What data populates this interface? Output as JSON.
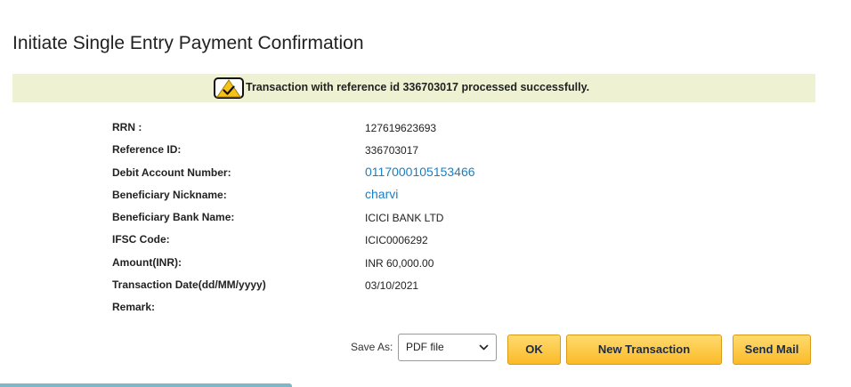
{
  "page": {
    "title": "Initiate Single Entry Payment Confirmation"
  },
  "banner": {
    "icon": "success-check-icon",
    "message": "Transaction with reference id 336703017 processed successfully.",
    "background": "#eef2d3"
  },
  "details": [
    {
      "label": "RRN :",
      "value": "127619623693",
      "link": false
    },
    {
      "label": "Reference ID:",
      "value": "336703017",
      "link": false
    },
    {
      "label": "Debit Account Number:",
      "value": "0117000105153466",
      "link": true
    },
    {
      "label": "Beneficiary Nickname:",
      "value": "charvi",
      "link": true
    },
    {
      "label": "Beneficiary Bank Name:",
      "value": "ICICI BANK LTD",
      "link": false
    },
    {
      "label": "IFSC Code:",
      "value": "ICIC0006292",
      "link": false
    },
    {
      "label": "Amount(INR):",
      "value": "INR 60,000.00",
      "link": false
    },
    {
      "label": "Transaction Date(dd/MM/yyyy)",
      "value": "03/10/2021",
      "link": false
    },
    {
      "label": "Remark:",
      "value": "",
      "link": false
    }
  ],
  "actions": {
    "save_as_label": "Save As:",
    "save_as_selected": "PDF file",
    "ok_label": "OK",
    "new_transaction_label": "New Transaction",
    "send_mail_label": "Send Mail"
  },
  "colors": {
    "link": "#1a7fc1",
    "button_top": "#fedb6e",
    "button_bottom": "#fbbb28"
  }
}
